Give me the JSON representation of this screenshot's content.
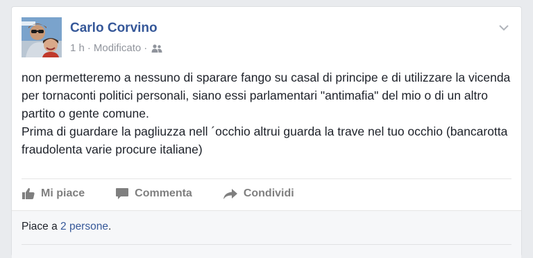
{
  "post": {
    "author": "Carlo Corvino",
    "time": "1 h",
    "separator": "·",
    "edited": "Modificato",
    "separator2": "·",
    "audience_icon": "friends-icon",
    "options_icon": "chevron-down-icon",
    "body_lines": [
      "non permetteremo a nessuno di sparare fango su casal di principe e di utilizzare la vicenda per tornaconti politici personali, siano essi parlamentari \"antimafia\" del mio o di un altro partito o gente comune.",
      "Prima di guardare la pagliuzza nell ´occhio altrui guarda la trave nel tuo occhio (bancarotta fraudolenta varie procure italiane)"
    ]
  },
  "actions": {
    "like": "Mi piace",
    "comment": "Commenta",
    "share": "Condividi"
  },
  "likes": {
    "prefix": "Piace a ",
    "link": "2 persone",
    "suffix": "."
  },
  "colors": {
    "author_link": "#365899",
    "meta_gray": "#90949c",
    "action_gray": "#7f7f7f",
    "footer_bg": "#f6f7f9"
  }
}
